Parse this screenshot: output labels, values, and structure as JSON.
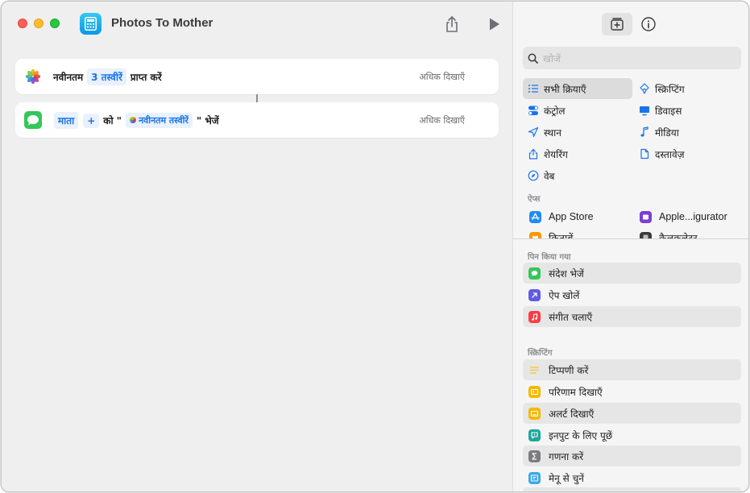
{
  "window": {
    "title": "Photos To Mother"
  },
  "workflow": {
    "actions": [
      {
        "app": "photos",
        "parts": [
          {
            "kind": "text",
            "value": "नवीनतम"
          },
          {
            "kind": "token",
            "value": "3 तस्वीरें"
          },
          {
            "kind": "text",
            "value": "प्राप्त करें"
          }
        ],
        "show_more": "अधिक दिखाएँ"
      },
      {
        "app": "messages",
        "recipient": "माता",
        "add": "+",
        "to_text": "को \"",
        "variable": "नवीनतम तस्वीरें",
        "end_text": "\" भेजें",
        "show_more": "अधिक दिखाएँ"
      }
    ]
  },
  "sidebar": {
    "search_placeholder": "खोजें",
    "categories": [
      {
        "label": "सभी क्रियाएँ",
        "icon": "list-icon",
        "selected": true
      },
      {
        "label": "स्क्रिप्टिंग",
        "icon": "scripting-icon"
      },
      {
        "label": "कंट्रोल",
        "icon": "toggle-icon"
      },
      {
        "label": "डिवाइस",
        "icon": "display-icon"
      },
      {
        "label": "स्थान",
        "icon": "location-arrow-icon"
      },
      {
        "label": "मीडिया",
        "icon": "music-note-icon"
      },
      {
        "label": "शेयरिंग",
        "icon": "share-icon"
      },
      {
        "label": "दस्तावेज़",
        "icon": "document-icon"
      },
      {
        "label": "वेब",
        "icon": "compass-icon"
      }
    ],
    "apps_header": "ऐप्स",
    "apps": [
      {
        "label": "App Store",
        "icon": "app-store-icon",
        "color": "#1e8cf5"
      },
      {
        "label": "Apple...igurator",
        "icon": "apple-configurator-icon",
        "color": "#7a3fd1"
      },
      {
        "label": "किताबें",
        "icon": "books-icon",
        "color": "#ff9500"
      },
      {
        "label": "कैलकुलेटर",
        "icon": "calculator-icon",
        "color": "#3a3a3c"
      }
    ],
    "pinned_header": "पिन किया गया",
    "pinned": [
      {
        "label": "संदेश भेजें",
        "icon": "message-icon",
        "color": "#34c759"
      },
      {
        "label": "ऐप खोलें",
        "icon": "open-app-icon",
        "color": "#5e5ce6"
      },
      {
        "label": "संगीत चलाएँ",
        "icon": "music-icon",
        "color": "#fc3c44"
      }
    ],
    "scripting_header": "स्क्रिप्टिंग",
    "scripting": [
      {
        "label": "टिप्पणी करें",
        "icon": "comment-lines-icon",
        "color": "#f2c94c"
      },
      {
        "label": "परिणाम दिखाएँ",
        "icon": "show-result-icon",
        "color": "#f5b800"
      },
      {
        "label": "अलर्ट दिखाएँ",
        "icon": "alert-icon",
        "color": "#f5b800"
      },
      {
        "label": "इनपुट के लिए पूछें",
        "icon": "ask-input-icon",
        "color": "#1fa79b"
      },
      {
        "label": "गणना करें",
        "icon": "sigma-icon",
        "color": "#7c7c80"
      },
      {
        "label": "मेनू से चुनें",
        "icon": "menu-icon",
        "color": "#3fa7e8"
      }
    ]
  }
}
